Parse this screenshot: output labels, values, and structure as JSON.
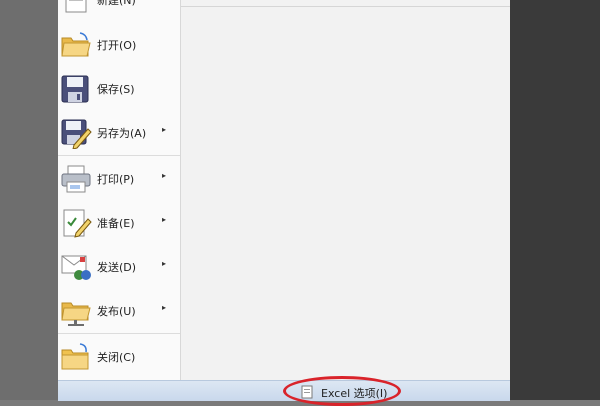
{
  "menu": {
    "items": [
      {
        "label": "新建(N)",
        "icon": "new-document-icon",
        "has_submenu": false
      },
      {
        "label": "打开(O)",
        "icon": "open-folder-icon",
        "has_submenu": false
      },
      {
        "label": "保存(S)",
        "icon": "save-floppy-icon",
        "has_submenu": false
      },
      {
        "label": "另存为(A)",
        "icon": "save-as-icon",
        "has_submenu": true
      },
      {
        "label": "打印(P)",
        "icon": "printer-icon",
        "has_submenu": true
      },
      {
        "label": "准备(E)",
        "icon": "prepare-document-icon",
        "has_submenu": true
      },
      {
        "label": "发送(D)",
        "icon": "send-icon",
        "has_submenu": true
      },
      {
        "label": "发布(U)",
        "icon": "publish-folder-icon",
        "has_submenu": true
      },
      {
        "label": "关闭(C)",
        "icon": "close-folder-icon",
        "has_submenu": false
      }
    ],
    "submenu_arrow": "▸"
  },
  "footer": {
    "options_label": "Excel 选项(I)",
    "options_icon": "options-document-icon"
  },
  "colors": {
    "highlight_circle": "#d9232a"
  }
}
